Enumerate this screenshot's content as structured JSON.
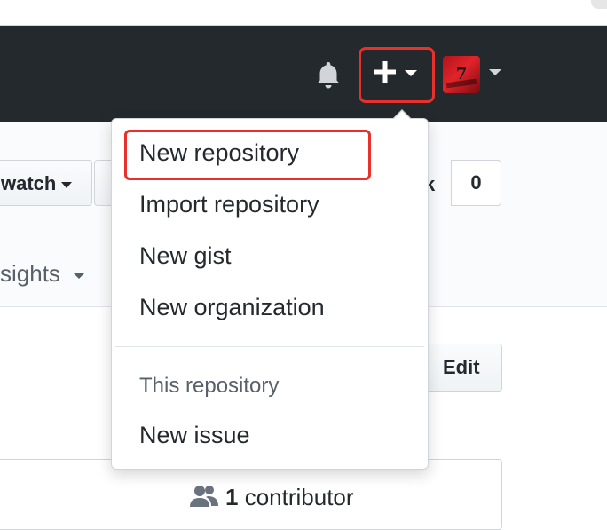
{
  "header": {
    "notifications_icon": "bell-icon",
    "create_icon": "plus-icon",
    "avatar_text": "7"
  },
  "repo": {
    "watch_label": "watch",
    "fork_tail": "k",
    "fork_count": "0",
    "insights_label": "sights",
    "edit_label": "Edit",
    "contributors_count": "1",
    "contributors_label": "contributor"
  },
  "dropdown": {
    "items": [
      {
        "label": "New repository"
      },
      {
        "label": "Import repository"
      },
      {
        "label": "New gist"
      },
      {
        "label": "New organization"
      }
    ],
    "section_header": "This repository",
    "section_items": [
      {
        "label": "New issue"
      }
    ]
  },
  "colors": {
    "header_bg": "#24292e",
    "highlight": "#e8312a"
  }
}
